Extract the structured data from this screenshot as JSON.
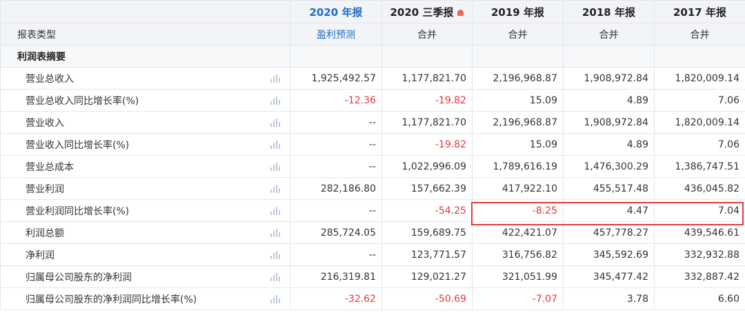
{
  "header": {
    "columns": [
      "2020 年报",
      "2020 三季报",
      "2019 年报",
      "2018 年报",
      "2017 年报"
    ],
    "q3_alert_icon": "bell-icon"
  },
  "type_row": {
    "label": "报表类型",
    "values": [
      "盈利预测",
      "合并",
      "合并",
      "合并",
      "合并"
    ]
  },
  "section": {
    "title": "利润表摘要"
  },
  "rows": [
    {
      "label": "营业总收入",
      "values": [
        "1,925,492.57",
        "1,177,821.70",
        "2,196,968.87",
        "1,908,972.84",
        "1,820,009.14"
      ]
    },
    {
      "label": "营业总收入同比增长率(%)",
      "values": [
        "-12.36",
        "-19.82",
        "15.09",
        "4.89",
        "7.06"
      ]
    },
    {
      "label": "营业收入",
      "values": [
        "--",
        "1,177,821.70",
        "2,196,968.87",
        "1,908,972.84",
        "1,820,009.14"
      ]
    },
    {
      "label": "营业收入同比增长率(%)",
      "values": [
        "--",
        "-19.82",
        "15.09",
        "4.89",
        "7.06"
      ]
    },
    {
      "label": "营业总成本",
      "values": [
        "--",
        "1,022,996.09",
        "1,789,616.19",
        "1,476,300.29",
        "1,386,747.51"
      ]
    },
    {
      "label": "营业利润",
      "values": [
        "282,186.80",
        "157,662.39",
        "417,922.10",
        "455,517.48",
        "436,045.82"
      ]
    },
    {
      "label": "营业利润同比增长率(%)",
      "values": [
        "--",
        "-54.25",
        "-8.25",
        "4.47",
        "7.04"
      ]
    },
    {
      "label": "利润总额",
      "values": [
        "285,724.05",
        "159,689.75",
        "422,421.07",
        "457,778.27",
        "439,546.61"
      ]
    },
    {
      "label": "净利润",
      "values": [
        "--",
        "123,771.57",
        "316,756.82",
        "345,592.69",
        "332,932.88"
      ]
    },
    {
      "label": "归属母公司股东的净利润",
      "values": [
        "216,319.81",
        "129,021.27",
        "321,051.99",
        "345,477.42",
        "332,887.42"
      ]
    },
    {
      "label": "归属母公司股东的净利润同比增长率(%)",
      "values": [
        "-32.62",
        "-50.69",
        "-7.07",
        "3.78",
        "6.60"
      ]
    }
  ],
  "colors": {
    "current_year": "#1e6cc8",
    "negative": "#e8363a",
    "highlight_border": "#e8363a",
    "header_bg": "#f2f4f7"
  },
  "row_chart_icon": "bar-chart-icon"
}
